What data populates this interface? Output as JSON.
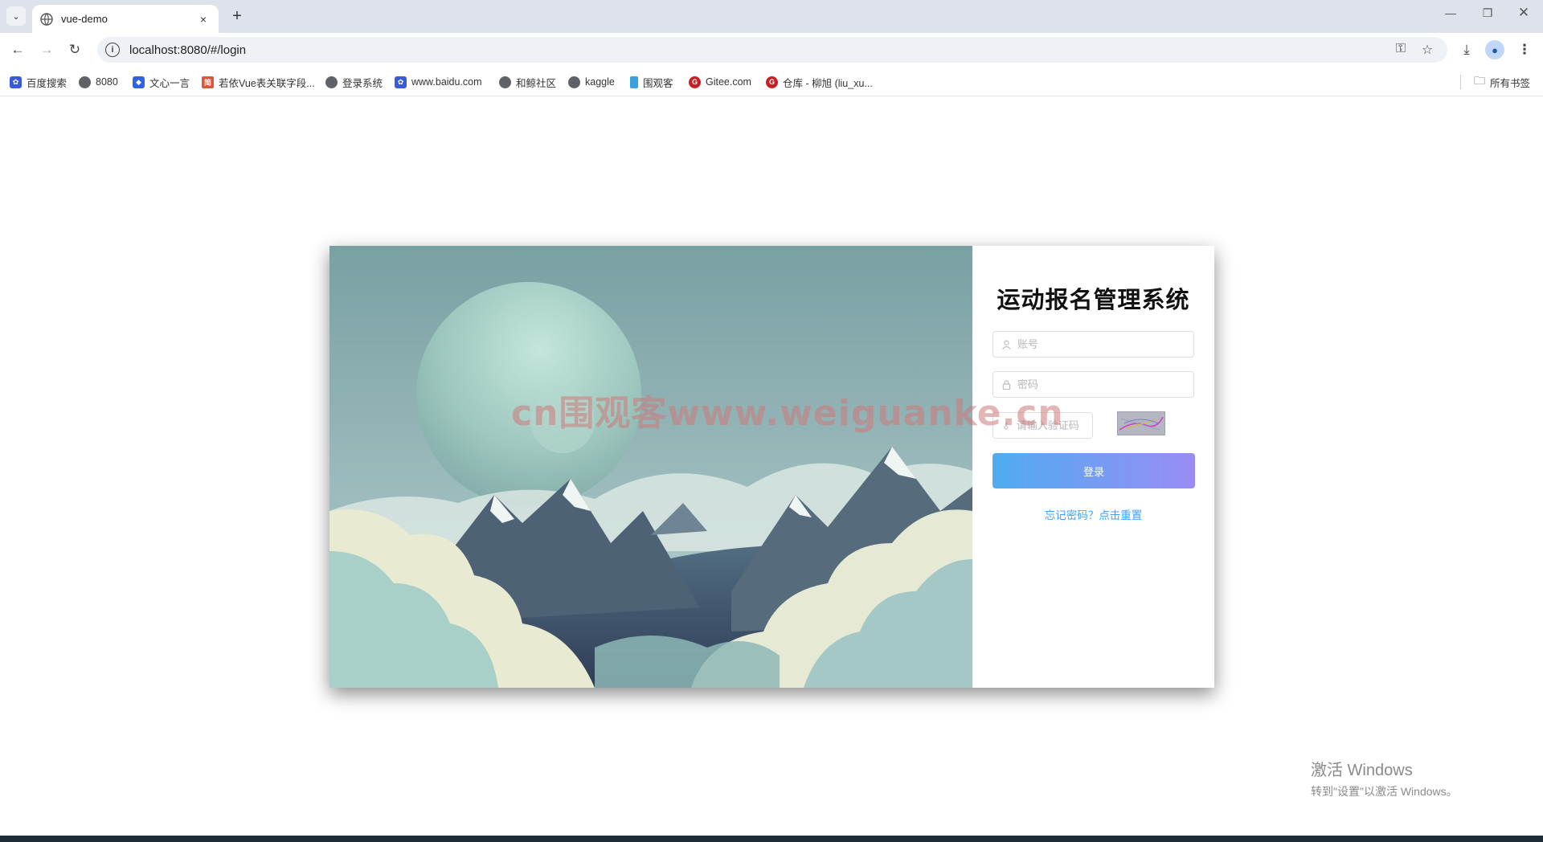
{
  "browser": {
    "tab_title": "vue-demo",
    "new_tab": "+",
    "close_tab": "×",
    "url": "localhost:8080/#/login"
  },
  "bookmarks": {
    "items": [
      {
        "label": "百度搜索",
        "color": "#3a5bd9"
      },
      {
        "label": "8080",
        "color": "#555555"
      },
      {
        "label": "文心一言",
        "color": "#2f63e0"
      },
      {
        "label": "若依Vue表关联字段...",
        "color": "#e0553a"
      },
      {
        "label": "登录系统",
        "color": "#555555"
      },
      {
        "label": "www.baidu.com",
        "color": "#3a5bd9"
      },
      {
        "label": "和鲸社区",
        "color": "#555555"
      },
      {
        "label": "kaggle",
        "color": "#555555"
      },
      {
        "label": "围观客",
        "color": "#3aa0e0"
      },
      {
        "label": "Gitee.com",
        "color": "#c71d23"
      },
      {
        "label": "仓库 - 柳旭 (liu_xu...",
        "color": "#c71d23"
      }
    ],
    "all_bookmarks": "所有书签"
  },
  "login": {
    "title": "运动报名管理系统",
    "username_placeholder": "账号",
    "password_placeholder": "密码",
    "captcha_placeholder": "请输入验证码",
    "login_button": "登录",
    "forgot_link": "忘记密码？点击重置",
    "button_gradient_start": "#4facef",
    "button_gradient_end": "#9a8cf5",
    "link_color": "#409eff"
  },
  "watermark": "cn围观客www.weiguanke.cn",
  "windows_activation": {
    "title": "激活 Windows",
    "subtitle": "转到\"设置\"以激活 Windows。"
  }
}
